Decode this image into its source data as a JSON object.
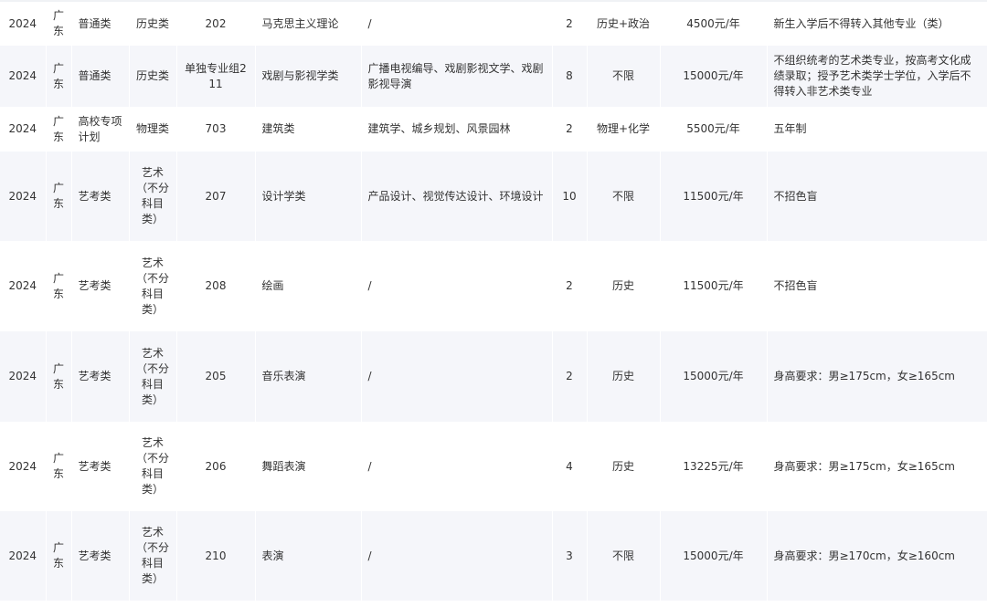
{
  "rows": [
    {
      "year": "2024",
      "province": "广东",
      "type": "普通类",
      "subject": "历史类",
      "group": "202",
      "major": "马克思主义理论",
      "directions": "/",
      "quota": "2",
      "requirement": "历史+政治",
      "tuition": "4500元/年",
      "note": "新生入学后不得转入其他专业（类）"
    },
    {
      "year": "2024",
      "province": "广东",
      "type": "普通类",
      "subject": "历史类",
      "group": "单独专业组211",
      "major": "戏剧与影视学类",
      "directions": "广播电视编导、戏剧影视文学、戏剧影视导演",
      "quota": "8",
      "requirement": "不限",
      "tuition": "15000元/年",
      "note": "不组织统考的艺术类专业，按高考文化成绩录取；授予艺术类学士学位，入学后不得转入非艺术类专业"
    },
    {
      "year": "2024",
      "province": "广东",
      "type": "高校专项计划",
      "subject": "物理类",
      "group": "703",
      "major": "建筑类",
      "directions": "建筑学、城乡规划、风景园林",
      "quota": "2",
      "requirement": "物理+化学",
      "tuition": "5500元/年",
      "note": "五年制"
    },
    {
      "year": "2024",
      "province": "广东",
      "type": "艺考类",
      "subject": "艺术（不分科目类）",
      "group": "207",
      "major": "设计学类",
      "directions": "产品设计、视觉传达设计、环境设计",
      "quota": "10",
      "requirement": "不限",
      "tuition": "11500元/年",
      "note": "不招色盲"
    },
    {
      "year": "2024",
      "province": "广东",
      "type": "艺考类",
      "subject": "艺术（不分科目类）",
      "group": "208",
      "major": "绘画",
      "directions": "/",
      "quota": "2",
      "requirement": "历史",
      "tuition": "11500元/年",
      "note": "不招色盲"
    },
    {
      "year": "2024",
      "province": "广东",
      "type": "艺考类",
      "subject": "艺术（不分科目类）",
      "group": "205",
      "major": "音乐表演",
      "directions": "/",
      "quota": "2",
      "requirement": "历史",
      "tuition": "15000元/年",
      "note": "身高要求：男≥175cm，女≥165cm"
    },
    {
      "year": "2024",
      "province": "广东",
      "type": "艺考类",
      "subject": "艺术（不分科目类）",
      "group": "206",
      "major": "舞蹈表演",
      "directions": "/",
      "quota": "4",
      "requirement": "历史",
      "tuition": "13225元/年",
      "note": "身高要求：男≥175cm，女≥165cm"
    },
    {
      "year": "2024",
      "province": "广东",
      "type": "艺考类",
      "subject": "艺术（不分科目类）",
      "group": "210",
      "major": "表演",
      "directions": "/",
      "quota": "3",
      "requirement": "不限",
      "tuition": "15000元/年",
      "note": "身高要求：男≥170cm，女≥160cm"
    }
  ]
}
